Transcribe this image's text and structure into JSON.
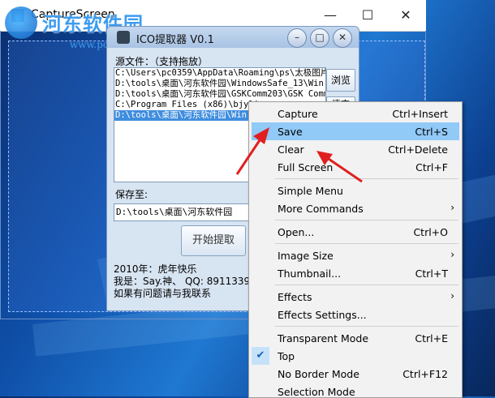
{
  "desktop": {},
  "capture_window": {
    "title": "CaptureScreen",
    "minimize_glyph": "—",
    "maximize_glyph": "☐",
    "close_glyph": "✕"
  },
  "watermark": {
    "brand": "河东软件园",
    "url": "www.pc0359.cn"
  },
  "ico_dialog": {
    "title": "ICO提取器 V0.1",
    "min_glyph": "–",
    "max_glyph": "□",
    "close_glyph": "✕",
    "source_label": "源文件：（支持拖放）",
    "source_files": [
      "C:\\Users\\pc0359\\AppData\\Roaming\\ps\\太极图片",
      "D:\\tools\\桌面\\河东软件园\\WindowsSafe_13\\Win",
      "D:\\tools\\桌面\\河东软件园\\GSKComm203\\GSK Comm",
      "C:\\Program Files (x86)\\bjyli",
      "D:\\tools\\桌面\\河东软件园\\Win"
    ],
    "browse_label": "浏览",
    "clear_label": "清空",
    "save_label": "保存至:",
    "save_path": "D:\\tools\\桌面\\河东软件园",
    "extract_label": "开始提取",
    "info_lines": [
      "2010年：虎年快乐",
      "我是：Say.神、 QQ: 89113398",
      "如果有问题请与我联系"
    ]
  },
  "context_menu": {
    "items": [
      {
        "label": "Capture",
        "shortcut": "Ctrl+Insert"
      },
      {
        "label": "Save",
        "shortcut": "Ctrl+S",
        "highlighted": true
      },
      {
        "label": "Clear",
        "shortcut": "Ctrl+Delete"
      },
      {
        "label": "Full Screen",
        "shortcut": "Ctrl+F"
      },
      {
        "label": "Simple Menu",
        "shortcut": ""
      },
      {
        "label": "More Commands",
        "submenu": true
      },
      {
        "label": "Open...",
        "shortcut": "Ctrl+O"
      },
      {
        "label": "Image Size",
        "submenu": true
      },
      {
        "label": "Thumbnail...",
        "shortcut": "Ctrl+T"
      },
      {
        "label": "Effects",
        "submenu": true
      },
      {
        "label": "Effects Settings...",
        "shortcut": ""
      },
      {
        "label": "Transparent Mode",
        "shortcut": "Ctrl+E"
      },
      {
        "label": "Top",
        "shortcut": "",
        "checked": true
      },
      {
        "label": "No Border Mode",
        "shortcut": "Ctrl+F12"
      },
      {
        "label": "Selection Mode",
        "shortcut": ""
      }
    ],
    "submenu_arrow": "›",
    "check_glyph": "✔"
  },
  "annotation_color": "#e02020",
  "highlight_color": "#91c9f7"
}
